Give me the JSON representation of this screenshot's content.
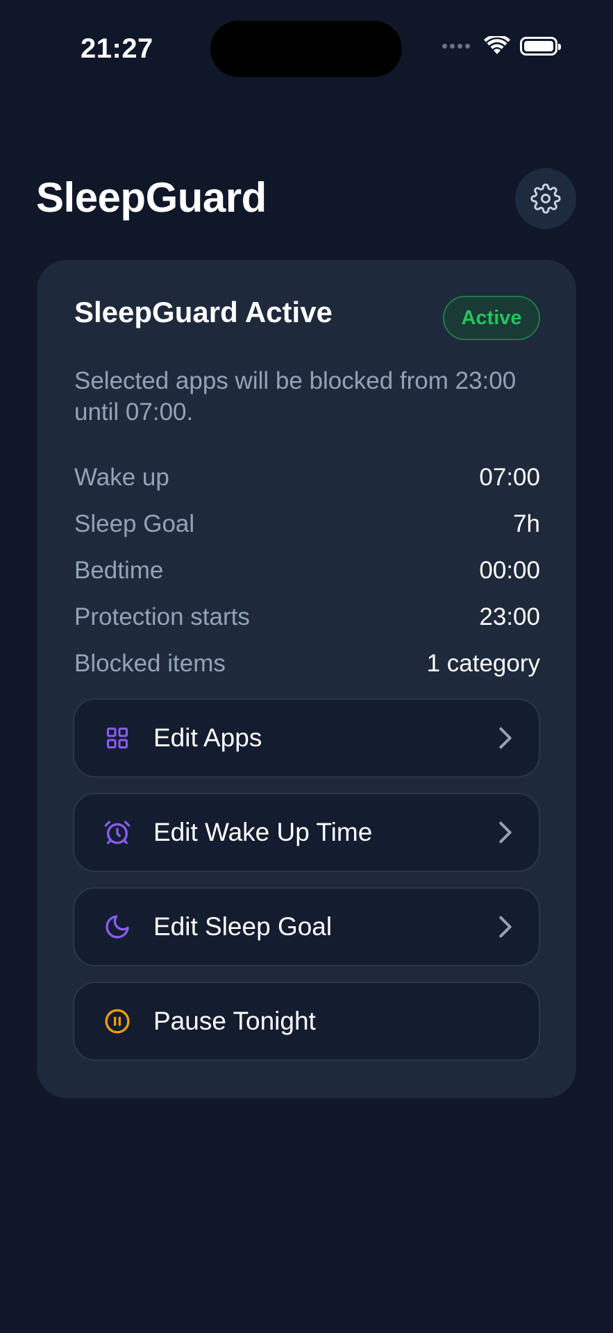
{
  "status_bar": {
    "time": "21:27"
  },
  "header": {
    "title": "SleepGuard",
    "settings_icon": "gear-icon"
  },
  "card": {
    "title": "SleepGuard Active",
    "badge": "Active",
    "description": "Selected apps will be blocked from 23:00 until 07:00.",
    "rows": [
      {
        "label": "Wake up",
        "value": "07:00"
      },
      {
        "label": "Sleep Goal",
        "value": "7h"
      },
      {
        "label": "Bedtime",
        "value": "00:00"
      },
      {
        "label": "Protection starts",
        "value": "23:00"
      },
      {
        "label": "Blocked items",
        "value": "1 category"
      }
    ],
    "actions": [
      {
        "label": "Edit Apps",
        "icon": "grid-icon"
      },
      {
        "label": "Edit Wake Up Time",
        "icon": "alarm-clock-icon"
      },
      {
        "label": "Edit Sleep Goal",
        "icon": "moon-icon"
      },
      {
        "label": "Pause Tonight",
        "icon": "pause-circle-icon"
      }
    ]
  },
  "colors": {
    "background": "#0f1729",
    "card": "#1e293b",
    "accent_purple": "#8b5cf6",
    "active_green": "#22c55e",
    "pause_orange": "#f59e0b"
  }
}
